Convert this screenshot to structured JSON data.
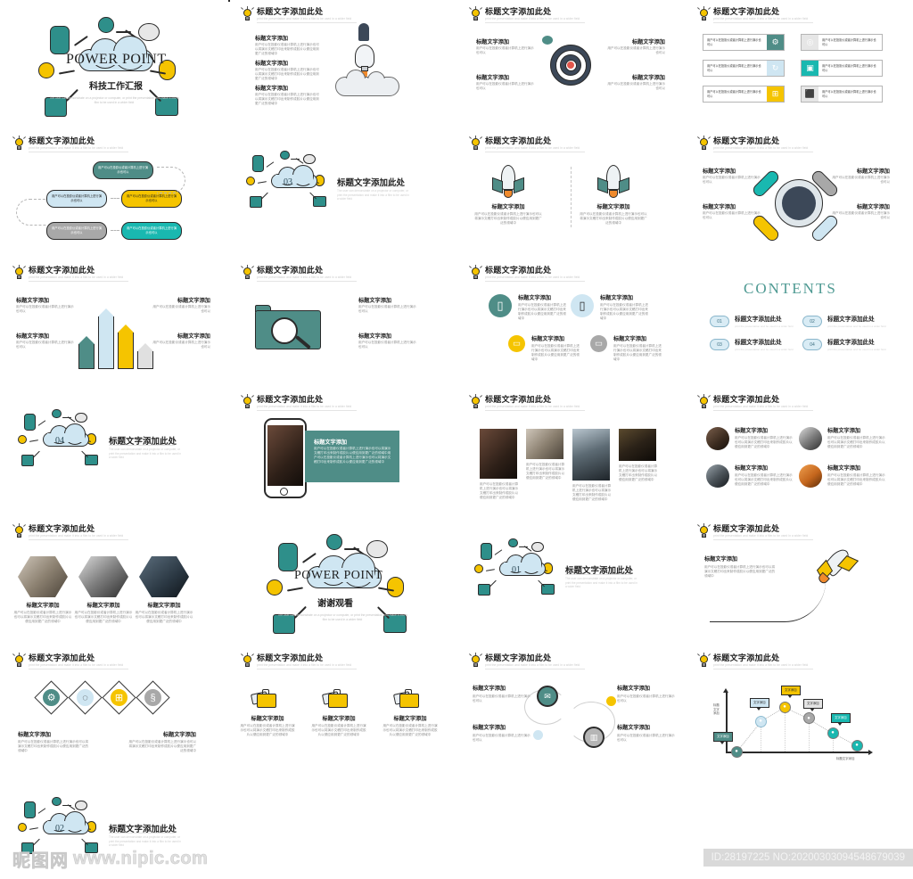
{
  "document": {
    "kind": "powerpoint-template-preview-sheet",
    "cover_title_en": "POWER POINT",
    "cover_title_cn": "科技工作汇报",
    "cover_caption": "The user can demonstrate on a projector or computer, or print the presentation and make it into a film to be used in a wider field",
    "thanks_cn": "谢谢观看",
    "contents_heading": "CONTENTS"
  },
  "common": {
    "slide_title": "标题文字添加此处",
    "slide_subtitle": "print the presentation and make it into a film to be used in a wider field",
    "block_title": "标题文字添加",
    "body_short": "用户可以在投影仪或者计算机上进行演示也可以",
    "body_mid": "用户可以在投影仪或者计算机上进行演示也可以将演示文稿打印出来制作成胶片以便应用到更广泛的领域中",
    "body_long": "用户可以在投影仪或者计算机上进行演示也可以将演示文稿打印出来制作成胶片以便应用到更广泛的领域中",
    "callout_label": "文字添加",
    "bulb_icon": "lightbulb-icon"
  },
  "slides": [
    {
      "index": 1,
      "name": "cover",
      "title": "POWER POINT"
    },
    {
      "index": 2,
      "name": "three-point-rocket",
      "title": "标题文字添加此处"
    },
    {
      "index": 3,
      "name": "four-point-target",
      "title": "标题文字添加此处"
    },
    {
      "index": 4,
      "name": "six-pill-list",
      "title": "标题文字添加此处"
    },
    {
      "index": 5,
      "name": "snake-flow",
      "title": "标题文字添加此处"
    },
    {
      "index": 6,
      "name": "section-divider-03",
      "title": "标题文字添加此处"
    },
    {
      "index": 7,
      "name": "two-rocket-compare",
      "title": "标题文字添加此处"
    },
    {
      "index": 8,
      "name": "four-arm-hub",
      "title": "标题文字添加此处"
    },
    {
      "index": 9,
      "name": "bar-chart-four",
      "title": "标题文字添加此处"
    },
    {
      "index": 10,
      "name": "folder-search-two",
      "title": "标题文字添加此处"
    },
    {
      "index": 11,
      "name": "four-device-circles",
      "title": "标题文字添加此处"
    },
    {
      "index": 12,
      "name": "contents",
      "title": "CONTENTS"
    },
    {
      "index": 13,
      "name": "section-divider-04",
      "title": "标题文字添加此处"
    },
    {
      "index": 14,
      "name": "phone-mockup",
      "title": "标题文字添加此处"
    },
    {
      "index": 15,
      "name": "four-photo-strip",
      "title": "标题文字添加此处"
    },
    {
      "index": 16,
      "name": "four-circle-photos",
      "title": "标题文字添加此处"
    },
    {
      "index": 17,
      "name": "three-hexagon",
      "title": "标题文字添加此处"
    },
    {
      "index": 18,
      "name": "thanks",
      "title": "谢谢观看"
    },
    {
      "index": 19,
      "name": "section-divider-01",
      "title": "标题文字添加此处"
    },
    {
      "index": 20,
      "name": "rocket-intro",
      "title": "标题文字添加此处"
    },
    {
      "index": 21,
      "name": "four-diamond-icons",
      "title": "标题文字添加此处"
    },
    {
      "index": 22,
      "name": "three-briefcase",
      "title": "标题文字添加此处"
    },
    {
      "index": 23,
      "name": "s-curve-four",
      "title": "标题文字添加此处"
    },
    {
      "index": 24,
      "name": "timeline-chart",
      "title": "标题文字添加此处"
    },
    {
      "index": 25,
      "name": "section-divider-02",
      "title": "标题文字添加此处"
    }
  ],
  "section_numbers": {
    "s6": "03",
    "s13": "04",
    "s19": "01",
    "s25": "02"
  },
  "contents": {
    "heading": "CONTENTS",
    "items": [
      {
        "num": "01",
        "label": "标题文字添加此处",
        "sub": "print the presentation and be used in a wider field"
      },
      {
        "num": "02",
        "label": "标题文字添加此处",
        "sub": "print the presentation and be used in a wider field"
      },
      {
        "num": "03",
        "label": "标题文字添加此处",
        "sub": "print the presentation and be used in a wider field"
      },
      {
        "num": "04",
        "label": "标题文字添加此处",
        "sub": "print the presentation and be used in a wider field"
      }
    ]
  },
  "pill_slide": {
    "items": [
      {
        "text": "用户可以在投影仪或者计算机上进行演示也可以",
        "icon": "gear-icon",
        "color": "#4f8d87",
        "side": "right"
      },
      {
        "text": "用户可以在投影仪或者计算机上进行演示也可以",
        "icon": "camera-icon",
        "color": "#e6e6e6",
        "side": "left"
      },
      {
        "text": "用户可以在投影仪或者计算机上进行演示也可以",
        "icon": "refresh-icon",
        "color": "#cfe6f2",
        "side": "right"
      },
      {
        "text": "用户可以在投影仪或者计算机上进行演示也可以",
        "icon": "monitor-icon",
        "color": "#19b8b0",
        "side": "left"
      },
      {
        "text": "用户可以在投影仪或者计算机上进行演示也可以",
        "icon": "window-icon",
        "color": "#f5c400",
        "side": "right"
      },
      {
        "text": "用户可以在投影仪或者计算机上进行演示也可以",
        "icon": "lock-icon",
        "color": "#e6e6e6",
        "side": "left"
      }
    ]
  },
  "flow_slide": {
    "boxes": [
      {
        "text": "用户可以在投影仪或者计算机上进行演示也可以",
        "color": "#4f8d87",
        "text_color": "#ffffff"
      },
      {
        "text": "用户可以在投影仪或者计算机上进行演示也可以",
        "color": "#f5c400",
        "text_color": "#1f1f1f"
      },
      {
        "text": "用户可以在投影仪或者计算机上进行演示也可以",
        "color": "#cfe6f2",
        "text_color": "#1f1f1f"
      },
      {
        "text": "用户可以在投影仪或者计算机上进行演示也可以",
        "color": "#19b8b0",
        "text_color": "#ffffff"
      },
      {
        "text": "用户可以在投影仪或者计算机上进行演示也可以",
        "color": "#a8a8a8",
        "text_color": "#ffffff"
      }
    ]
  },
  "device_slide": {
    "items": [
      {
        "label": "标题文字添加",
        "icon": "tablet-icon",
        "color": "#4f8d87"
      },
      {
        "label": "标题文字添加",
        "icon": "smartphone-icon",
        "color": "#cfe6f2"
      },
      {
        "label": "标题文字添加",
        "icon": "laptop-icon",
        "color": "#f5c400"
      },
      {
        "label": "标题文字添加",
        "icon": "monitor-icon",
        "color": "#a8a8a8"
      }
    ]
  },
  "diamond_slide": {
    "items": [
      {
        "icon": "gear-icon",
        "color": "#4f8d87"
      },
      {
        "icon": "aperture-icon",
        "color": "#cfe6f2"
      },
      {
        "icon": "grid-icon",
        "color": "#f5c400"
      },
      {
        "icon": "dollar-icon",
        "color": "#a8a8a8"
      }
    ]
  },
  "scurve_slide": {
    "nodes": [
      {
        "icon": "mail-icon",
        "color": "#4f8d87"
      },
      {
        "icon": "dot",
        "color": "#f5c400"
      },
      {
        "icon": "dot",
        "color": "#cfe6f2"
      },
      {
        "icon": "layout-icon",
        "color": "#a8a8a8"
      }
    ]
  },
  "chart_data": {
    "type": "line",
    "title": "标题文字添加此处",
    "xlabel": "标题文字添加",
    "ylabel": "标题文字添加",
    "x": [
      0,
      1,
      2,
      3,
      4,
      5
    ],
    "values": [
      0,
      58,
      86,
      64,
      36,
      12
    ],
    "point_labels": [
      "文字添加",
      "文字添加",
      "文字添加",
      "文字添加",
      "文字添加",
      "文字添加"
    ],
    "point_colors": [
      "#4f8d87",
      "#cfe6f2",
      "#f5c400",
      "#a8a8a8",
      "#19b8b0",
      "#19b8b0"
    ],
    "point_icons": [
      "lock-icon",
      "monitor-icon",
      "search-icon",
      "gear-icon",
      "send-icon",
      "send-icon"
    ],
    "grid": false,
    "legend": "none",
    "ylim": [
      0,
      100
    ]
  },
  "bar_chart": {
    "type": "bar",
    "title": "标题文字添加此处",
    "categories": [
      "1",
      "2",
      "3",
      "4"
    ],
    "values": [
      52,
      95,
      70,
      40
    ],
    "colors": [
      "#4f8d87",
      "#cfe6f2",
      "#f5c400",
      "#e0e0e0"
    ],
    "side_labels": [
      {
        "title": "标题文字添加",
        "body": "用户可以在投影仪或者计算机上进行演示也可以同演示文稿"
      },
      {
        "title": "标题文字添加",
        "body": "用户可以在投影仪或者计算机上进行演示也可以同演示文稿"
      },
      {
        "title": "标题文字添加",
        "body": "用户可以在投影仪或者计算机上进行演示也可以同演示文稿"
      },
      {
        "title": "标题文字添加",
        "body": "用户可以在投影仪或者计算机上进行演示也可以同演示文稿"
      }
    ],
    "ylim": [
      0,
      100
    ]
  },
  "footer": {
    "watermark_cn": "昵图网",
    "watermark_url": "www.nipic.com",
    "id_text": "ID:28197225 NO:20200303094548679039"
  }
}
